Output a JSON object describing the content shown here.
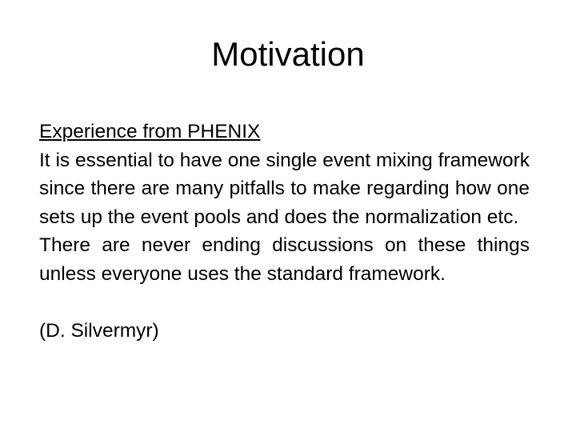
{
  "slide": {
    "title": "Motivation",
    "section_heading": "Experience from PHENIX",
    "paragraphs": [
      "It is essential to have one single event mixing framework since there are many pitfalls to make regarding how one sets up the event pools and does the normalization etc.",
      "There are never ending discussions on these things unless everyone uses the standard framework."
    ],
    "attribution": "(D. Silvermyr)"
  }
}
